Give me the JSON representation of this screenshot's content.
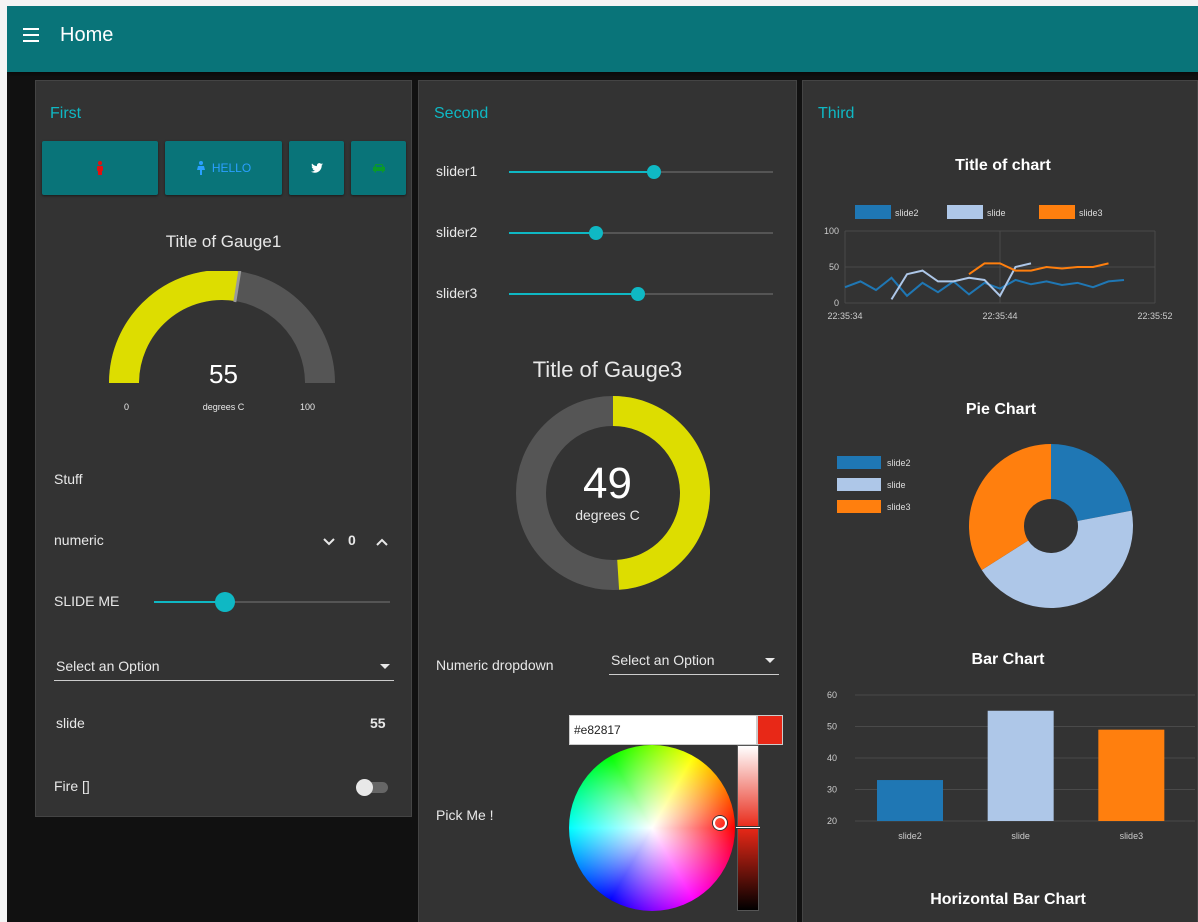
{
  "header": {
    "title": "Home"
  },
  "panels": {
    "first": {
      "title": "First",
      "buttons": {
        "hello_label": "HELLO"
      },
      "gauge1": {
        "title": "Title of Gauge1",
        "value": "55",
        "units": "degrees C",
        "min": "0",
        "max": "100",
        "fraction": 0.55,
        "color": "#dddd00"
      },
      "text_stuff": "Stuff",
      "numeric": {
        "label": "numeric",
        "value": "0"
      },
      "slide_me": {
        "label": "SLIDE ME",
        "fraction": 0.3
      },
      "dropdown": {
        "placeholder": "Select an Option"
      },
      "slide_text": {
        "label": "slide",
        "value": "55"
      },
      "switch": {
        "label": "Fire []",
        "on": false
      }
    },
    "second": {
      "title": "Second",
      "sliders": [
        {
          "label": "slider1",
          "fraction": 0.55
        },
        {
          "label": "slider2",
          "fraction": 0.33
        },
        {
          "label": "slider3",
          "fraction": 0.49
        }
      ],
      "gauge3": {
        "title": "Title of Gauge3",
        "value": "49",
        "units": "degrees C",
        "fraction": 0.49,
        "color": "#dddd00"
      },
      "numeric_dropdown": {
        "label": "Numeric dropdown",
        "placeholder": "Select an Option"
      },
      "color_picker": {
        "label": "Pick Me !",
        "hex": "#e82817",
        "color": "#e82817"
      }
    },
    "third": {
      "title": "Third",
      "line_chart_title": "Title of chart",
      "pie_chart_title": "Pie Chart",
      "bar_chart_title": "Bar Chart",
      "hbar_chart_title": "Horizontal Bar Chart"
    }
  },
  "chart_data": [
    {
      "type": "line",
      "title": "Title of chart",
      "ylim": [
        0,
        100
      ],
      "y_ticks": [
        "100",
        "50",
        "0"
      ],
      "x_ticks": [
        "22:35:34",
        "22:35:44",
        "22:35:52"
      ],
      "legend_position": "top",
      "series": [
        {
          "name": "slide2",
          "color": "#1f77b4",
          "x": [
            0,
            1,
            2,
            3,
            4,
            5,
            6,
            7,
            8,
            9,
            10,
            11,
            12,
            13,
            14,
            15,
            16,
            17,
            18
          ],
          "y": [
            22,
            30,
            18,
            35,
            10,
            28,
            15,
            30,
            12,
            28,
            20,
            32,
            26,
            30,
            25,
            28,
            22,
            30,
            32
          ]
        },
        {
          "name": "slide",
          "color": "#aec7e8",
          "x": [
            3,
            4,
            5,
            6,
            7,
            8,
            9,
            10,
            11,
            12
          ],
          "y": [
            5,
            40,
            45,
            30,
            30,
            35,
            32,
            10,
            50,
            55
          ]
        },
        {
          "name": "slide3",
          "color": "#ff7f0e",
          "x": [
            8,
            9,
            10,
            11,
            12,
            13,
            14,
            15,
            16,
            17
          ],
          "y": [
            40,
            55,
            55,
            45,
            45,
            50,
            48,
            50,
            50,
            55
          ]
        }
      ]
    },
    {
      "type": "pie",
      "title": "Pie Chart",
      "legend_position": "left",
      "categories": [
        "slide2",
        "slide",
        "slide3"
      ],
      "values": [
        22,
        44,
        34
      ],
      "colors": [
        "#1f77b4",
        "#aec7e8",
        "#ff7f0e"
      ]
    },
    {
      "type": "bar",
      "title": "Bar Chart",
      "categories": [
        "slide2",
        "slide",
        "slide3"
      ],
      "values": [
        33,
        55,
        49
      ],
      "colors": [
        "#1f77b4",
        "#aec7e8",
        "#ff7f0e"
      ],
      "ylim": [
        20,
        60
      ],
      "y_ticks": [
        "60",
        "50",
        "40",
        "30",
        "20"
      ]
    }
  ]
}
